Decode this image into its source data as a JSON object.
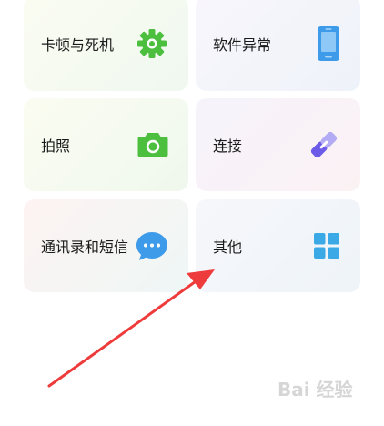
{
  "cards": [
    {
      "label": "卡顿与死机",
      "icon": "gear-icon"
    },
    {
      "label": "软件异常",
      "icon": "phone-icon"
    },
    {
      "label": "拍照",
      "icon": "camera-icon"
    },
    {
      "label": "连接",
      "icon": "link-icon"
    },
    {
      "label": "通讯录和短信",
      "icon": "chat-bubble-icon"
    },
    {
      "label": "其他",
      "icon": "grid-icon"
    }
  ],
  "colors": {
    "green": "#4cbf3f",
    "blue": "#3d9be9",
    "purple": "#6c5ae8",
    "arrow": "#ee3b3b"
  },
  "watermark": {
    "text": "Bai 经验"
  }
}
